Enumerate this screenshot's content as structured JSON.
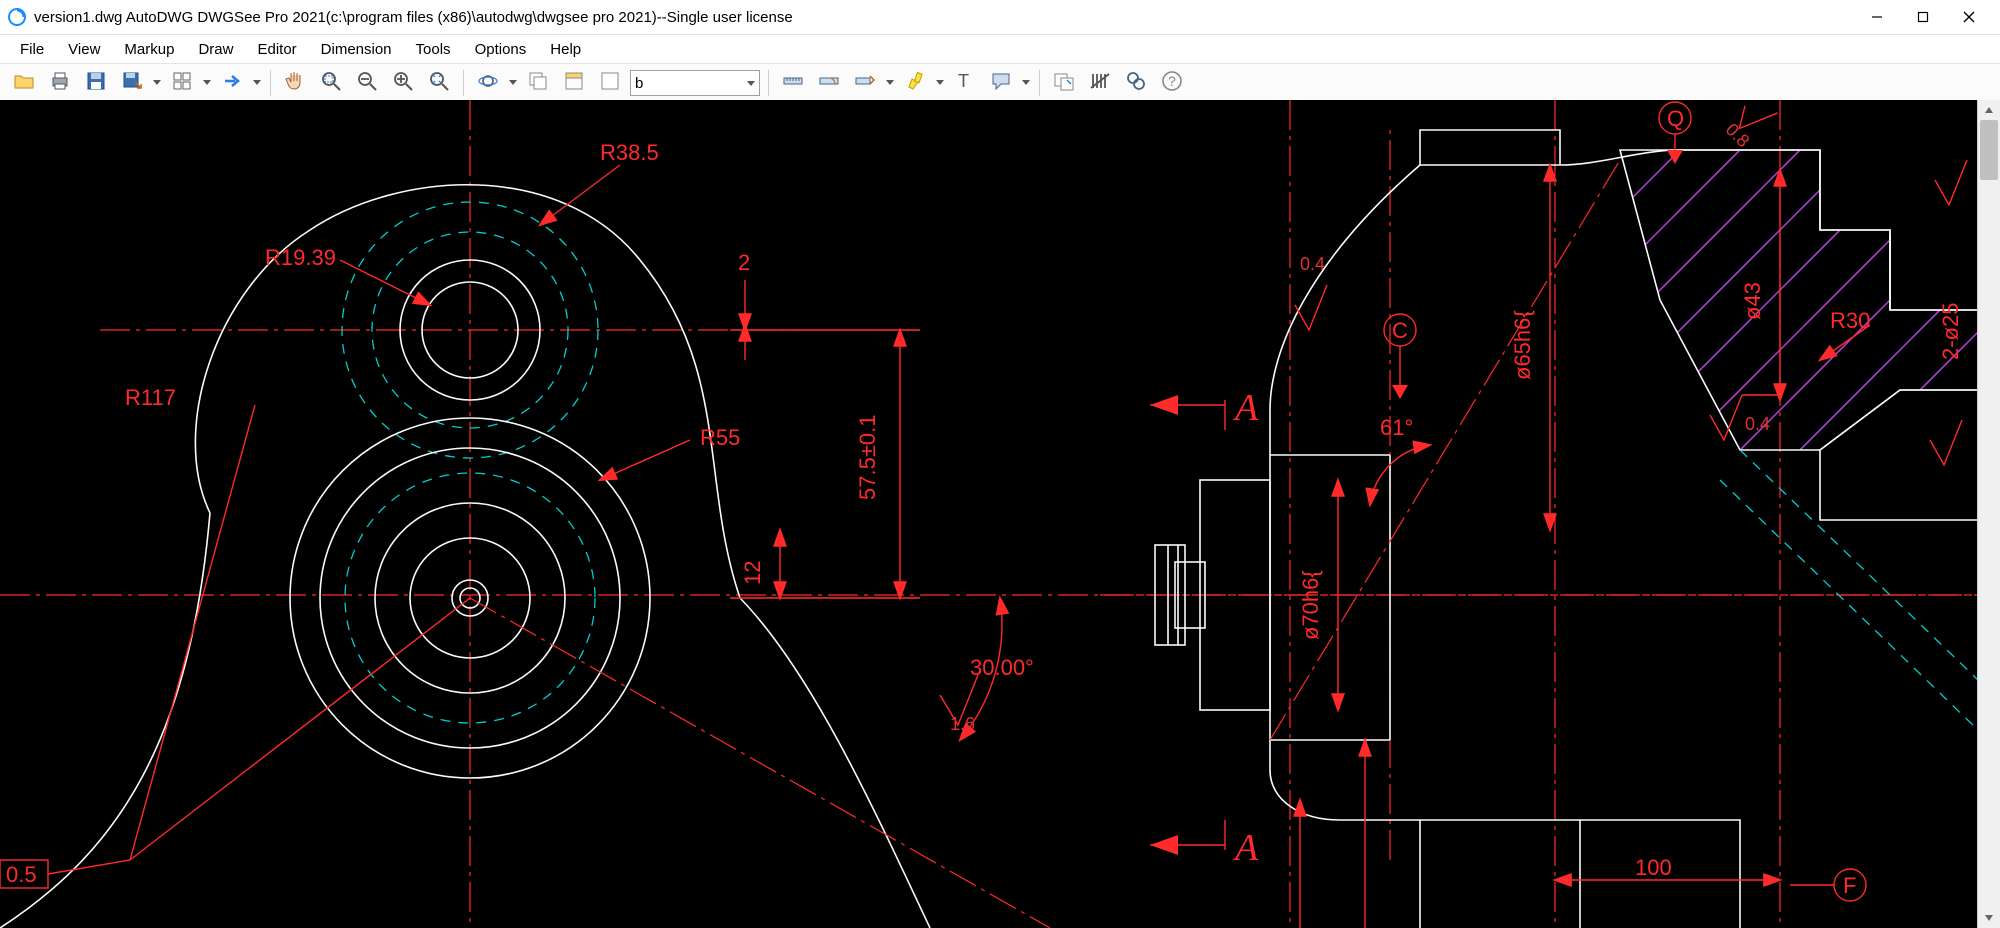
{
  "window": {
    "title": "version1.dwg AutoDWG DWGSee Pro 2021(c:\\program files (x86)\\autodwg\\dwgsee pro 2021)--Single user license"
  },
  "menu": {
    "items": [
      "File",
      "View",
      "Markup",
      "Draw",
      "Editor",
      "Dimension",
      "Tools",
      "Options",
      "Help"
    ]
  },
  "toolbar": {
    "layer_value": "b",
    "icons": [
      "open-folder-icon",
      "print-icon",
      "save-icon",
      "save-as-icon",
      "view-mode-icon",
      "forward-icon",
      "pan-icon",
      "zoom-window-icon",
      "zoom-out-icon",
      "zoom-in-icon",
      "zoom-extents-icon",
      "orbit-icon",
      "layers-icon",
      "layer-props-icon",
      "layer-iso-icon",
      "measure-distance-icon",
      "measure-angle-icon",
      "measure-area-icon",
      "highlighter-icon",
      "text-icon",
      "comment-icon",
      "export-image-icon",
      "count-icon",
      "find-icon",
      "help-icon"
    ]
  },
  "drawing": {
    "dimensions": {
      "r38_5": "R38.5",
      "r19_39": "R19.39",
      "r117": "R117",
      "r55": "R55",
      "h57_5": "57.5±0.1",
      "v2": "2",
      "v12": "12",
      "angle30": "30.00°",
      "surf_1_6": "1.6",
      "tol_0_5": "0.5",
      "surf_0_4_left": "0.4",
      "angle61": "61°",
      "dia70h6": "ø70h6{",
      "dia65h6": "ø65h6{",
      "dia43": "ø43",
      "len100": "100",
      "surf_0_4_right": "0.4",
      "surf_0_8": "0.8",
      "r30": "R30",
      "two_dia25": "2-ø25",
      "gd_Q": "Q",
      "gd_C": "C",
      "gd_F": "F"
    },
    "section_letter": "A"
  }
}
